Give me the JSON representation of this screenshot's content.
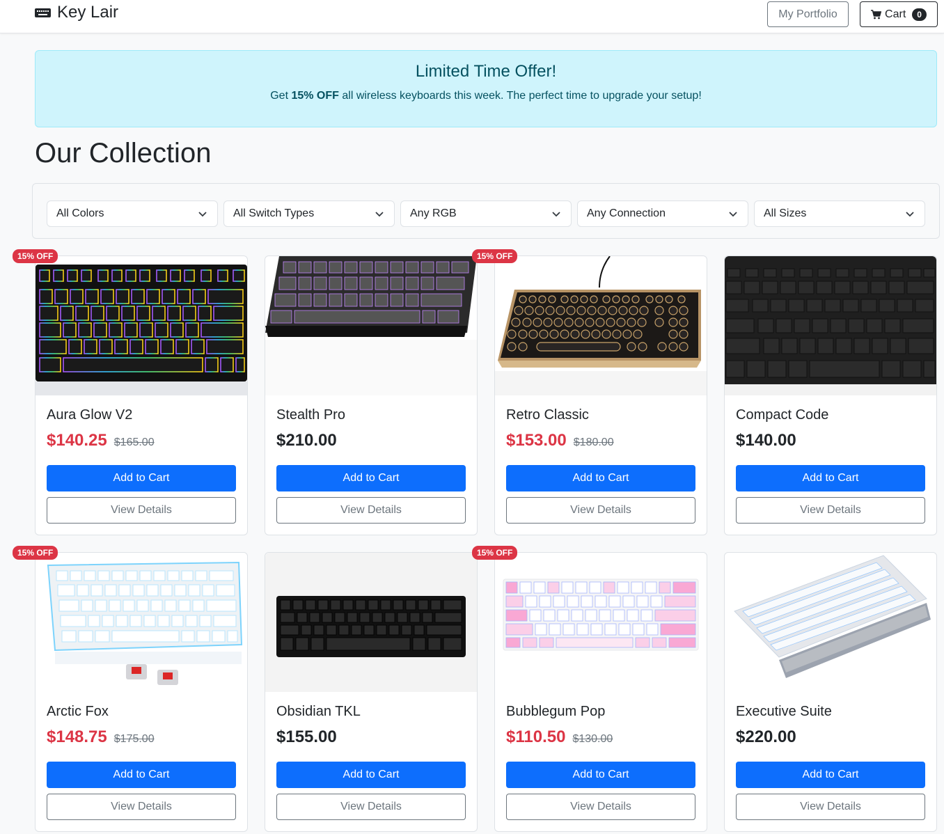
{
  "header": {
    "brand": "Key Lair",
    "portfolio_label": "My Portfolio",
    "cart_label": "Cart",
    "cart_count": "0"
  },
  "promo": {
    "title": "Limited Time Offer!",
    "text_prefix": "Get ",
    "text_bold": "15% OFF",
    "text_suffix": " all wireless keyboards this week. The perfect time to upgrade your setup!"
  },
  "page_title": "Our Collection",
  "filters": [
    {
      "value": "All Colors"
    },
    {
      "value": "All Switch Types"
    },
    {
      "value": "Any RGB"
    },
    {
      "value": "Any Connection"
    },
    {
      "value": "All Sizes"
    }
  ],
  "products": [
    {
      "name": "Aura Glow V2",
      "price": "$140.25",
      "old_price": "$165.00",
      "badge": "15% OFF",
      "image": "rgb-keyboard"
    },
    {
      "name": "Stealth Pro",
      "price": "$210.00",
      "old_price": "",
      "badge": "",
      "image": "dark-mechanical-keyboard"
    },
    {
      "name": "Retro Classic",
      "price": "$153.00",
      "old_price": "$180.00",
      "badge": "15% OFF",
      "image": "typewriter-keyboard"
    },
    {
      "name": "Compact Code",
      "price": "$140.00",
      "old_price": "",
      "badge": "",
      "image": "slim-black-keyboard"
    },
    {
      "name": "Arctic Fox",
      "price": "$148.75",
      "old_price": "$175.00",
      "badge": "15% OFF",
      "image": "white-keyboard"
    },
    {
      "name": "Obsidian TKL",
      "price": "$155.00",
      "old_price": "",
      "badge": "",
      "image": "black-compact-keyboard"
    },
    {
      "name": "Bubblegum Pop",
      "price": "$110.50",
      "old_price": "$130.00",
      "badge": "15% OFF",
      "image": "pink-keyboard"
    },
    {
      "name": "Executive Suite",
      "price": "$220.00",
      "old_price": "",
      "badge": "",
      "image": "white-keyboard-wrist-rest"
    }
  ],
  "buttons": {
    "add_to_cart": "Add to Cart",
    "view_details": "View Details"
  },
  "colors": {
    "primary": "#0d6efd",
    "sale": "#dc3545",
    "promo_bg": "#cff4fc",
    "promo_text": "#055160"
  }
}
